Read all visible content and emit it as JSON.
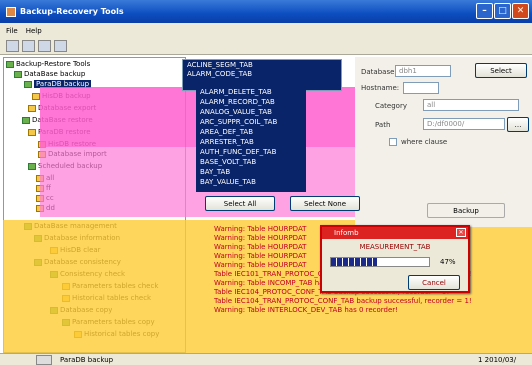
{
  "window": {
    "title": "Backup-Recovery Tools"
  },
  "menu": {
    "file": "File",
    "help": "Help"
  },
  "tree": {
    "items": [
      {
        "label": "Backup-Restore Tools"
      },
      {
        "label": "DataBase backup"
      },
      {
        "label": "ParaDB backup",
        "selected": true
      },
      {
        "label": "HisDB backup"
      },
      {
        "label": "Database export"
      },
      {
        "label": "DataBase restore"
      },
      {
        "label": "ParaDB restore"
      },
      {
        "label": "HisDB restore"
      },
      {
        "label": "Database import"
      },
      {
        "label": "Scheduled backup"
      },
      {
        "label": "all"
      },
      {
        "label": "ff"
      },
      {
        "label": "cc"
      },
      {
        "label": "dd"
      },
      {
        "label": "DataBase management"
      },
      {
        "label": "Database information"
      },
      {
        "label": "HisDB clear"
      },
      {
        "label": "Database consistency"
      },
      {
        "label": "Consistency check"
      },
      {
        "label": "Parameters tables check"
      },
      {
        "label": "Historical tables check"
      },
      {
        "label": "Database copy"
      },
      {
        "label": "Parameters tables copy"
      },
      {
        "label": "Historical tables copy"
      }
    ]
  },
  "tables": {
    "top_items": [
      "ACLINE_SEGM_TAB",
      "ALARM_CODE_TAB"
    ],
    "popup_items": [
      "ALARM_DELETE_TAB",
      "ALARM_RECORD_TAB",
      "ANALOG_VALUE_TAB",
      "ARC_SUPPR_COIL_TAB",
      "AREA_DEF_TAB",
      "ARRESTER_TAB",
      "AUTH_FUNC_DEF_TAB",
      "BASE_VOLT_TAB",
      "BAY_TAB",
      "BAY_VALUE_TAB"
    ]
  },
  "settings": {
    "database_label": "Database:",
    "database_value": "dbh1",
    "select_label": "Select",
    "hostname_label": "Hostname:",
    "category_label": "Category",
    "category_value": "all",
    "path_label": "Path",
    "path_value": "D:/df0000/",
    "where_label": "where clause",
    "select_all_label": "Select All",
    "select_none_label": "Select None",
    "backup_label": "Backup"
  },
  "progress": {
    "title": "Infomb",
    "table": "MEASUREMENT_TAB",
    "percent": 47,
    "percent_text": "47%",
    "cancel_label": "Cancel"
  },
  "log": {
    "lines": [
      "Warning: Table HOURPDAT",
      "Warning: Table HOURPDAT",
      "Warning: Table HOURPDAT",
      "Warning: Table HOURPDAT",
      "Warning: Table HOURPDAT",
      "Table IEC101_TRAN_PROTOC_CONF_TAB backup successful, recorder = 1!",
      "Warning: Table INCOMP_TAB has 0 recorder!",
      "Table IEC104_PROTOC_CONF_TAB backup successful, recorder = 5!",
      "Table IEC104_TRAN_PROTOC_CONF_TAB backup successful, recorder = 1!",
      "Warning: Table INTERLOCK_DEV_TAB has 0 recorder!"
    ]
  },
  "status": {
    "left": "ParaDB backup",
    "right": "1 2010/03/"
  },
  "colors": {
    "titlebar": "#0c4ec0",
    "selection": "#0a246a",
    "warning_text": "#c00020",
    "progress_fill": "#1c2a8a"
  }
}
